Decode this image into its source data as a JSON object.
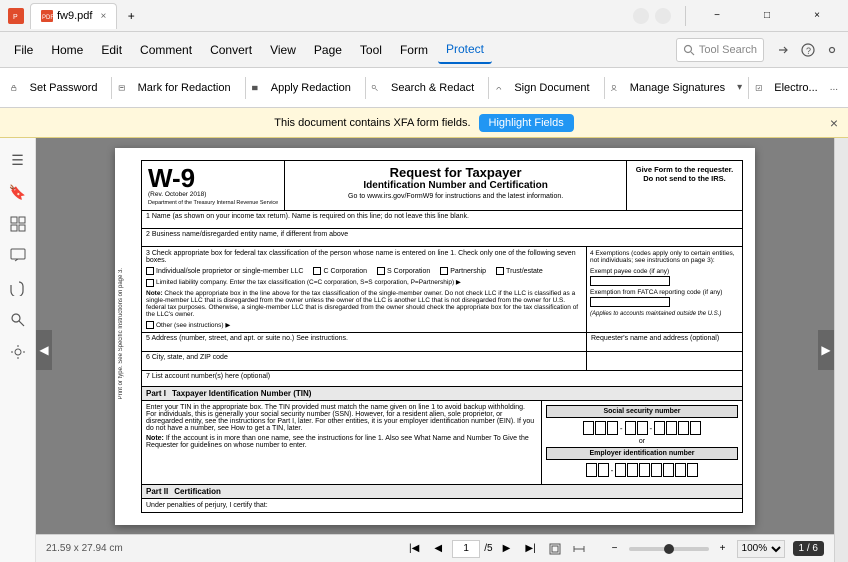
{
  "titlebar": {
    "app_icon": "pdf-icon",
    "tab_title": "fw9.pdf",
    "close_tab": "×",
    "add_tab": "+",
    "min_label": "−",
    "max_label": "□",
    "close_label": "×"
  },
  "ribbon": {
    "file_label": "File",
    "home_label": "Home",
    "edit_label": "Edit",
    "comment_label": "Comment",
    "convert_label": "Convert",
    "view_label": "View",
    "page_label": "Page",
    "tool_label": "Tool",
    "form_label": "Form",
    "protect_label": "Protect",
    "search_placeholder": "Tool Search"
  },
  "toolbar": {
    "set_password_label": "Set Password",
    "mark_redaction_label": "Mark for Redaction",
    "apply_redaction_label": "Apply Redaction",
    "search_redact_label": "Search & Redact",
    "sign_document_label": "Sign Document",
    "manage_signatures_label": "Manage Signatures",
    "electronic_label": "Electro..."
  },
  "notification": {
    "message": "This document contains XFA form fields.",
    "highlight_btn": "Highlight Fields",
    "close": "×"
  },
  "sidebar": {
    "icons": [
      "☰",
      "🔖",
      "🔍",
      "💬",
      "📎",
      "🔧"
    ]
  },
  "document": {
    "form_number": "W-9",
    "form_revision": "(Rev. October 2018)",
    "form_dept": "Department of the Treasury  Internal Revenue Service",
    "form_title": "Request for Taxpayer",
    "form_subtitle": "Identification Number and Certification",
    "form_url": "Go to www.irs.gov/FormW9 for instructions and the latest information.",
    "give_form_text": "Give Form to the requester. Do not send to the IRS.",
    "field1_label": "1  Name (as shown on your income tax return). Name is required on this line; do not leave this line blank.",
    "field2_label": "2  Business name/disregarded entity name, if different from above",
    "field3_label": "3  Check appropriate box for federal tax classification of the person whose name is entered on line 1. Check only one of the following seven boxes.",
    "exemptions_label": "4  Exemptions (codes apply only to certain entities, not individuals; see instructions on page 3):",
    "exempt_payee_label": "Exempt payee code (if any)",
    "fatca_label": "Exemption from FATCA reporting code (if any)",
    "applies_note": "(Applies to accounts maintained outside the U.S.)",
    "cb_sole": "Individual/sole proprietor or single-member LLC",
    "cb_c_corp": "C Corporation",
    "cb_s_corp": "S Corporation",
    "cb_partner": "Partnership",
    "cb_trust": "Trust/estate",
    "llc_label": "Limited liability company. Enter the tax classification (C=C corporation, S=S corporation, P=Partnership) ▶",
    "note_label": "Note:",
    "note_text": "Check the appropriate box in the line above for the tax classification of the single-member owner. Do not check LLC if the LLC is classified as a single-member LLC that is disregarded from the owner unless the owner of the LLC is another LLC that is not disregarded from the owner for U.S. federal tax purposes. Otherwise, a single-member LLC that is disregarded from the owner should check the appropriate box for the tax classification of the LLC's owner.",
    "other_label": "Other (see instructions) ▶",
    "field5_label": "5  Address (number, street, and apt. or suite no.) See instructions.",
    "field5b_label": "Requester's name and address (optional)",
    "field6_label": "6  City, state, and ZIP code",
    "field7_label": "7  List account number(s) here (optional)",
    "part1_label": "Part I",
    "part1_title": "Taxpayer Identification Number (TIN)",
    "tin_text": "Enter your TIN in the appropriate box. The TIN provided must match the name given on line 1 to avoid backup withholding. For individuals, this is generally your social security number (SSN). However, for a resident alien, sole proprietor, or disregarded entity, see the instructions for Part I, later. For other entities, it is your employer identification number (EIN). If you do not have a number, see How to get a TIN, later.",
    "note2_label": "Note:",
    "note2_text": "If the account is in more than one name, see the instructions for line 1. Also see What Name and Number To Give the Requester for guidelines on whose number to enter.",
    "ssn_label": "Social security number",
    "or_label": "or",
    "ein_label": "Employer identification number",
    "part2_label": "Part II",
    "part2_title": "Certification",
    "cert_under_penalties": "Under penalties of perjury, I certify that:",
    "page_count": "1 / 6",
    "page_size": "21.59 x 27.94 cm",
    "page_input_value": "1",
    "page_total": "/5",
    "zoom_level": "100%"
  },
  "bottombar": {
    "page_size": "21.59 x 27.94 cm",
    "page_count": "1 / 6",
    "zoom_value": "100%",
    "zoom_label": "100%"
  }
}
